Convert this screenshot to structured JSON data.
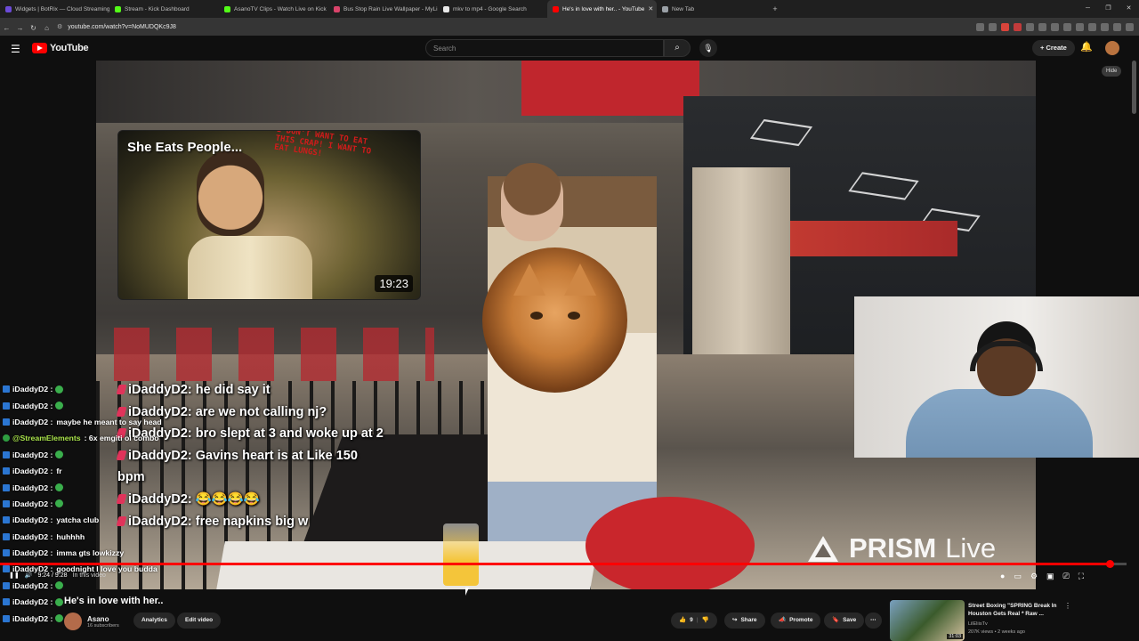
{
  "browser": {
    "tabs": [
      {
        "title": "Widgets | BotRix — Cloud Streaming",
        "color": "#6c4bd8",
        "active": false
      },
      {
        "title": "Stream - Kick Dashboard",
        "color": "#53fc18",
        "active": false
      },
      {
        "title": "AsanoTV Clips - Watch Live on Kick",
        "color": "#53fc18",
        "active": false
      },
      {
        "title": "Bus Stop Rain Live Wallpaper - MyLi...",
        "color": "#d9436a",
        "active": false
      },
      {
        "title": "mkv to mp4 - Google Search",
        "color": "#e8e8e8",
        "active": false
      },
      {
        "title": "He's in love with her.. - YouTube",
        "color": "#ff0000",
        "active": true
      },
      {
        "title": "New Tab",
        "color": "#9aa0a6",
        "active": false
      }
    ],
    "url": "youtube.com/watch?v=NoMUDQKc9J8"
  },
  "youtube": {
    "brand": "YouTube",
    "search_placeholder": "Search",
    "create_label": "Create"
  },
  "overlay": {
    "thumbnail": {
      "title": "She Eats People...",
      "caption": "I DON'T WANT TO EAT THIS CRAP! I WANT TO EAT LUNGS!",
      "duration": "19:23"
    },
    "prism": {
      "brand": "PRISM",
      "word": "Live"
    },
    "hide_label": "Hide",
    "chat_lines": [
      {
        "user": "iDaddyD2:",
        "text": "he did say it",
        "dim": false
      },
      {
        "user": "iDaddyD2:",
        "text": "are we not calling nj?",
        "dim": false
      },
      {
        "user": "iDaddyD2:",
        "text": "bro slept at 3 and woke up at 2",
        "dim": false
      },
      {
        "user": "iDaddyD2:",
        "text": "Gavins heart is at Like 150 bpm",
        "dim": false
      },
      {
        "user": "iDaddyD2:",
        "text": "😂😂😂😂",
        "dim": false
      },
      {
        "user": "iDaddyD2:",
        "text": "free napkins big w",
        "dim": false
      }
    ]
  },
  "sidechat": [
    {
      "user": "iDaddyD2 :",
      "msg": "",
      "emote": true,
      "type": "user"
    },
    {
      "user": "iDaddyD2 :",
      "msg": "",
      "emote": true,
      "type": "user"
    },
    {
      "user": "iDaddyD2 :",
      "msg": "maybe he meant to say head",
      "emote": false,
      "type": "user"
    },
    {
      "user": "@StreamElements",
      "msg": ": 6x emgiti ol combo",
      "emote": false,
      "type": "se"
    },
    {
      "user": "iDaddyD2 :",
      "msg": "",
      "emote": true,
      "type": "user"
    },
    {
      "user": "iDaddyD2 :",
      "msg": "fr",
      "emote": false,
      "type": "user"
    },
    {
      "user": "iDaddyD2 :",
      "msg": "",
      "emote": true,
      "type": "user"
    },
    {
      "user": "iDaddyD2 :",
      "msg": "",
      "emote": true,
      "type": "user"
    },
    {
      "user": "iDaddyD2 :",
      "msg": "yatcha club",
      "emote": false,
      "type": "user"
    },
    {
      "user": "iDaddyD2 :",
      "msg": "huhhhh",
      "emote": false,
      "type": "user"
    },
    {
      "user": "iDaddyD2 :",
      "msg": "imma gts lowkizzy",
      "emote": false,
      "type": "user"
    },
    {
      "user": "iDaddyD2 :",
      "msg": "goodnight I love you budda",
      "emote": false,
      "type": "user"
    },
    {
      "user": "iDaddyD2 :",
      "msg": "",
      "emote": true,
      "type": "user"
    },
    {
      "user": "iDaddyD2 :",
      "msg": "",
      "emote": true,
      "type": "user"
    },
    {
      "user": "iDaddyD2 :",
      "msg": "",
      "emote": true,
      "type": "user"
    }
  ],
  "player": {
    "time": "9:24 / 9:28",
    "chapter": "In this video",
    "progress": 0.985
  },
  "video": {
    "title": "He's in love with her..",
    "channel": "Asano",
    "subscribers": "16 subscribers",
    "analytics_label": "Analytics",
    "edit_label": "Edit video",
    "likes": "9",
    "share_label": "Share",
    "promote_label": "Promote",
    "save_label": "Save"
  },
  "recommendation": {
    "title": "Street Boxing \"SPRING Break In Houston Gets Real * Raw ...",
    "channel": "LilEliisTv",
    "meta": "207K views • 2 weeks ago",
    "duration": "31:03"
  }
}
